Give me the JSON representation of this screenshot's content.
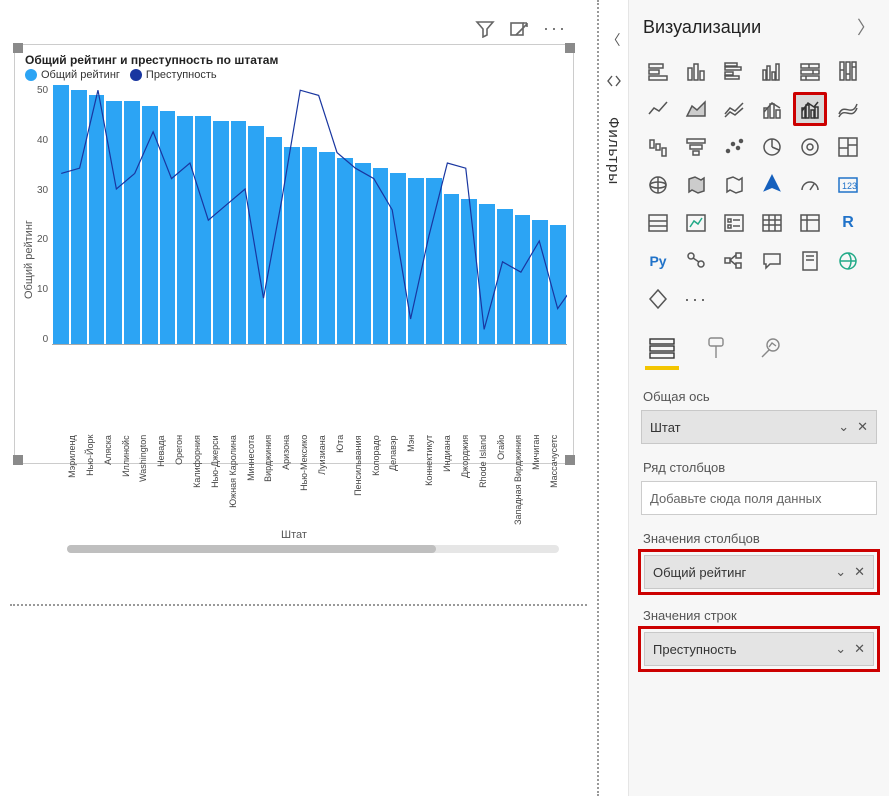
{
  "toolbar": {},
  "filters_label": "Фильтры",
  "viz": {
    "header": "Визуализации"
  },
  "field_tabs": {},
  "sections": {
    "shared_axis": "Общая ось",
    "shared_axis_field": "Штат",
    "column_series": "Ряд столбцов",
    "column_series_placeholder": "Добавьте сюда поля данных",
    "column_values": "Значения столбцов",
    "column_values_field": "Общий рейтинг",
    "line_values": "Значения строк",
    "line_values_field": "Преступность"
  },
  "chart_data": {
    "type": "bar+line",
    "title": "Общий рейтинг и преступность по штатам",
    "xlabel": "Штат",
    "ylabel": "Общий рейтинг",
    "ylim": [
      0,
      50
    ],
    "yticks": [
      0,
      10,
      20,
      30,
      40,
      50
    ],
    "legend": [
      {
        "name": "Общий рейтинг",
        "kind": "bar",
        "color": "#2ca4f4"
      },
      {
        "name": "Преступность",
        "kind": "line",
        "color": "#1936a0"
      }
    ],
    "categories": [
      "Мэриленд",
      "Нью-Йорк",
      "Аляска",
      "Иллинойс",
      "Washington",
      "Невада",
      "Орегон",
      "Калифорния",
      "Нью-Джерси",
      "Южная Каролина",
      "Миннесота",
      "Вирджиния",
      "Аризона",
      "Нью-Мексико",
      "Луизиана",
      "Юта",
      "Пенсильвания",
      "Колорадо",
      "Делавэр",
      "Мэн",
      "Коннектикут",
      "Индиана",
      "Джорджия",
      "Rhode Island",
      "Огайо",
      "Западная Вирджиния",
      "Мичиган",
      "Массачусетс"
    ],
    "series": [
      {
        "name": "Общий рейтинг",
        "type": "bar",
        "values": [
          50,
          49,
          48,
          47,
          47,
          46,
          45,
          44,
          44,
          43,
          43,
          42,
          40,
          38,
          38,
          37,
          36,
          35,
          34,
          33,
          32,
          32,
          29,
          28,
          27,
          26,
          25,
          24,
          23
        ]
      },
      {
        "name": "Преступность",
        "type": "line",
        "values": [
          33,
          34,
          49,
          30,
          33,
          41,
          32,
          35,
          24,
          27,
          30,
          9,
          28,
          49,
          48,
          37,
          34,
          32,
          26,
          5,
          21,
          35,
          34,
          3,
          16,
          14,
          20,
          7,
          12
        ]
      }
    ]
  }
}
